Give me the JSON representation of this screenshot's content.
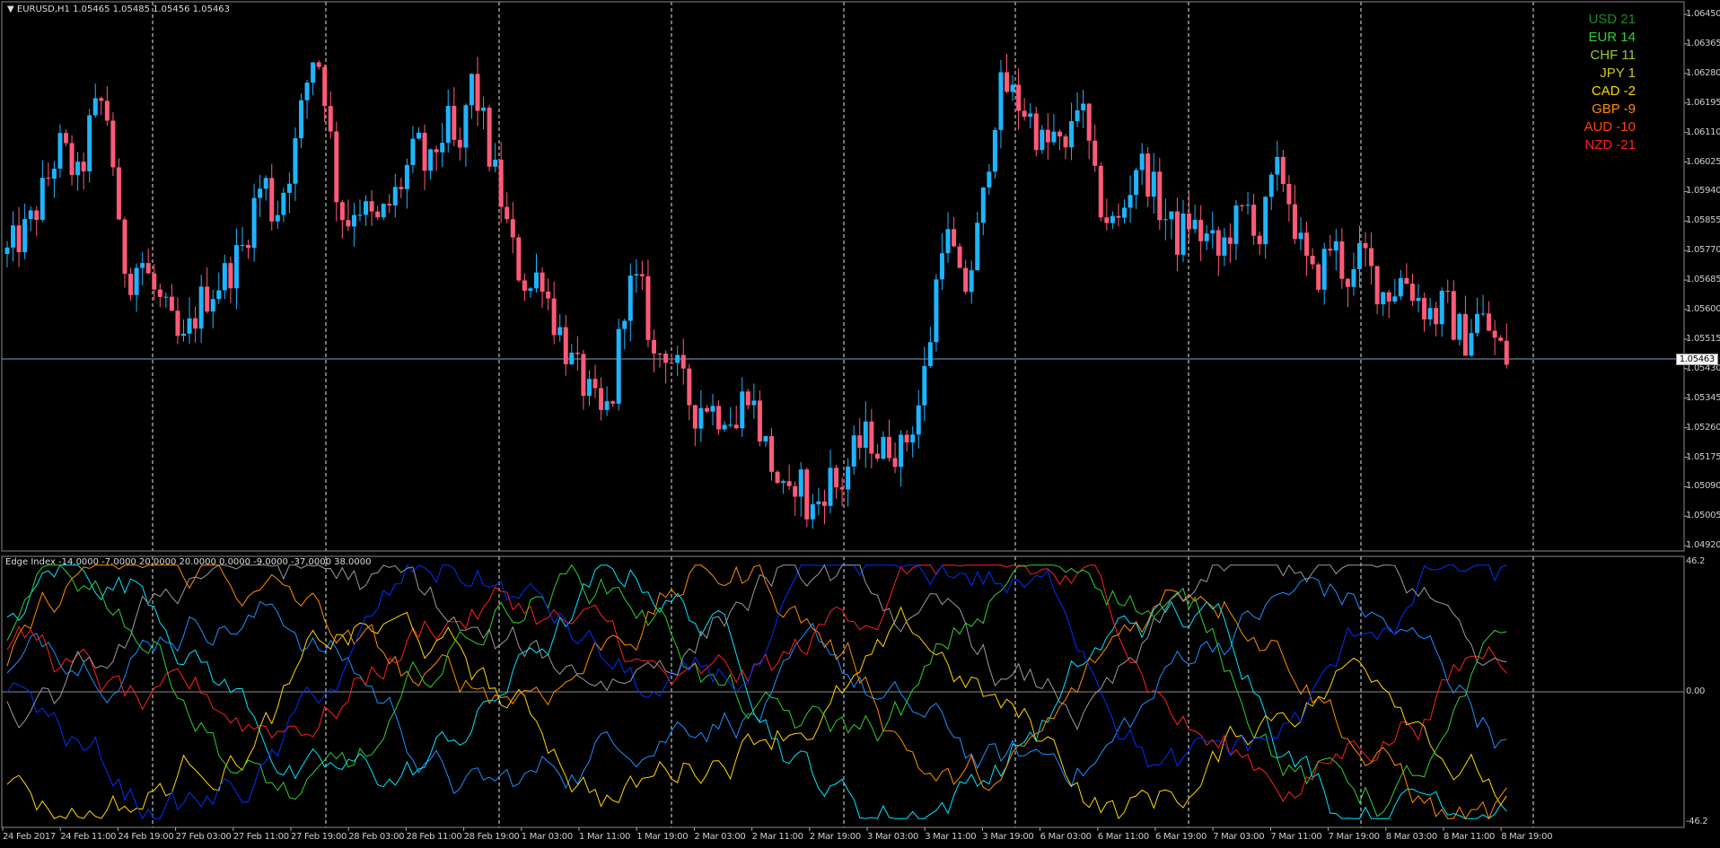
{
  "window": {
    "symbol_header": "EURUSD,H1  1.05465 1.05485 1.05456 1.05463",
    "indicator_header": "Edge Index -14.0000 -7.0000 20.0000 20.0000 0.0000 -9.0000 -37.0000 38.0000",
    "current_price": "1.05463"
  },
  "price_axis": [
    "1.06450",
    "1.06365",
    "1.06280",
    "1.06195",
    "1.06110",
    "1.06025",
    "1.05940",
    "1.05855",
    "1.05770",
    "1.05685",
    "1.05600",
    "1.05515",
    "1.05430",
    "1.05345",
    "1.05260",
    "1.05175",
    "1.05090",
    "1.05005",
    "1.04920"
  ],
  "indicator_axis": [
    "46.2",
    "0.00",
    "-46.2"
  ],
  "time_axis": [
    "24 Feb 2017",
    "24 Feb 11:00",
    "24 Feb 19:00",
    "27 Feb 03:00",
    "27 Feb 11:00",
    "27 Feb 19:00",
    "28 Feb 03:00",
    "28 Feb 11:00",
    "28 Feb 19:00",
    "1 Mar 03:00",
    "1 Mar 11:00",
    "1 Mar 19:00",
    "2 Mar 03:00",
    "2 Mar 11:00",
    "2 Mar 19:00",
    "3 Mar 03:00",
    "3 Mar 11:00",
    "3 Mar 19:00",
    "6 Mar 03:00",
    "6 Mar 11:00",
    "6 Mar 19:00",
    "7 Mar 03:00",
    "7 Mar 11:00",
    "7 Mar 19:00",
    "8 Mar 03:00",
    "8 Mar 11:00",
    "8 Mar 19:00"
  ],
  "strength_list": [
    {
      "label": "USD 21",
      "color": "#1e8c1e"
    },
    {
      "label": "EUR 14",
      "color": "#32cd32"
    },
    {
      "label": "CHF 11",
      "color": "#9acd32"
    },
    {
      "label": "JPY 1",
      "color": "#c8c820"
    },
    {
      "label": "CAD -2",
      "color": "#ffd700"
    },
    {
      "label": "GBP -9",
      "color": "#ff8c00"
    },
    {
      "label": "AUD -10",
      "color": "#ff4500"
    },
    {
      "label": "NZD -21",
      "color": "#ff2020"
    }
  ],
  "colors": {
    "bull": "#1eb4ff",
    "bear": "#ff5a78",
    "grid": "#ffffff",
    "axis": "#c0c0c0"
  },
  "chart_data": {
    "type": "candlestick",
    "price_range": [
      1.0492,
      1.0645
    ],
    "indicator_range": [
      -46.2,
      46.2
    ],
    "price_path": [
      1.0576,
      1.058,
      1.0583,
      1.059,
      1.0598,
      1.0607,
      1.0603,
      1.0596,
      1.0612,
      1.062,
      1.0614,
      1.0576,
      1.057,
      1.0575,
      1.0567,
      1.0561,
      1.0555,
      1.0548,
      1.0556,
      1.0563,
      1.0566,
      1.0569,
      1.0573,
      1.0578,
      1.059,
      1.0598,
      1.0586,
      1.0596,
      1.0606,
      1.0623,
      1.0636,
      1.0622,
      1.0595,
      1.0584,
      1.0592,
      1.0587,
      1.0584,
      1.0589,
      1.0594,
      1.0601,
      1.0607,
      1.0598,
      1.0609,
      1.0613,
      1.0601,
      1.0627,
      1.0618,
      1.0604,
      1.0593,
      1.0579,
      1.057,
      1.0566,
      1.0572,
      1.0559,
      1.0552,
      1.0544,
      1.0539,
      1.0533,
      1.0528,
      1.0536,
      1.0562,
      1.0568,
      1.0563,
      1.0545,
      1.055,
      1.0544,
      1.0536,
      1.0531,
      1.0534,
      1.053,
      1.0532,
      1.0526,
      1.054,
      1.0528,
      1.0519,
      1.0511,
      1.0502,
      1.0515,
      1.05,
      1.0505,
      1.0512,
      1.0508,
      1.0516,
      1.0521,
      1.0524,
      1.0518,
      1.0522,
      1.0519,
      1.0526,
      1.0535,
      1.0555,
      1.0582,
      1.0578,
      1.0563,
      1.0574,
      1.059,
      1.0615,
      1.0625,
      1.0621,
      1.0618,
      1.0613,
      1.0606,
      1.061,
      1.0602,
      1.0623,
      1.0612,
      1.0594,
      1.0587,
      1.0583,
      1.0592,
      1.0603,
      1.0599,
      1.0591,
      1.0585,
      1.058,
      1.0586,
      1.0582,
      1.058,
      1.0575,
      1.0583,
      1.0586,
      1.059,
      1.058,
      1.0594,
      1.0601,
      1.059,
      1.0577,
      1.0568,
      1.0572,
      1.058,
      1.0572,
      1.0568,
      1.0577,
      1.0569,
      1.0565,
      1.0566,
      1.057,
      1.0565,
      1.0561,
      1.0558,
      1.0562,
      1.0555,
      1.0552,
      1.0558,
      1.0556,
      1.055,
      1.0546
    ]
  }
}
